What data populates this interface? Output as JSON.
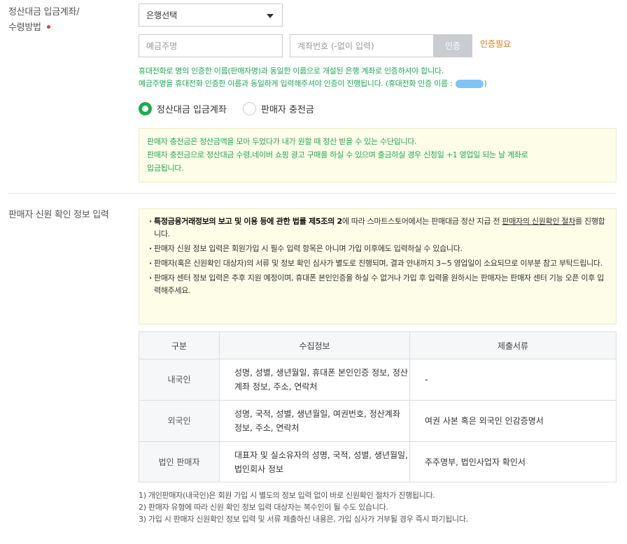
{
  "settlement": {
    "label_line1": "정산대금 입금계좌/",
    "label_line2": "수령방법",
    "bank_select": "은행선택",
    "depositor_placeholder": "예금주명",
    "account_placeholder": "계좌번호 (-없이 입력)",
    "auth_button": "인증",
    "auth_status": "인증필요",
    "note_line1": "휴대전화로 명의 인증한 이름(판매자명)과 동일한 이름으로 개설된 은행 계좌로 인증하셔야 합니다.",
    "note_line2_prefix": "예금주명을 휴대전화 인증한 이름과 동일하게 입력해주셔야 인증이 진행됩니다. (휴대전화 인증 이름 :",
    "note_line2_suffix": ")",
    "radio_account": "정산대금 입금계좌",
    "radio_charge": "판매자 충전금",
    "charge_info_line1": "판매자 충전금은 정산금액을 모아 두었다가 내가 원할 때 정산 받을 수 있는 수단입니다.",
    "charge_info_line2": "판매자 충전금으로 정산대금 수령,네이버 쇼핑 광고 구매를 하실 수 있으며 출금하실 경우 신청일 +1 영업일 되는 날 계좌로",
    "charge_info_line3": "입금됩니다."
  },
  "credit": {
    "label": "판매자 신원 확인 정보 입력",
    "notice1_bold": "특정금융거래정보의 보고 및 이용 등에 관한 법률 제5조의 2",
    "notice1_mid": "에 따라 스마트스토어에서는 판매대금 정산 지급 전 ",
    "notice1_link": "판매자의 신원확인 절차",
    "notice1_end": "를 진행합니다.",
    "notice2": "판매자 신원 정보 입력은 회원가입 시 필수 입력 항목은 아니며 가입 이후에도 입력하실 수 있습니다.",
    "notice3": "판매자(혹은 신원확인 대상자)의 서류 및 정보 확인 심사가 별도로 진행되며, 결과 안내까지 3~5 영업일이 소요되므로 이부분 참고 부탁드립니다.",
    "notice4": "판매자 센터 정보 입력은 추후 지원 예정이며, 휴대폰 본인인증을 하실 수 없거나 가입 후 입력을 원하시는 판매자는 판매자 센터 기능 오픈 이후 입력해주세요.",
    "table": {
      "headers": [
        "구분",
        "수집정보",
        "제출서류"
      ],
      "rows": [
        {
          "type": "내국인",
          "info": "성명, 성별, 생년월일, 휴대폰 본인인증 정보, 정산계좌 정보, 주소, 연락처",
          "docs": "-"
        },
        {
          "type": "외국인",
          "info": "성명, 국적, 성별, 생년월일, 여권번호, 정산계좌 정보, 주소, 연락처",
          "docs": "여권 사본 혹은 외국인 인감증명서"
        },
        {
          "type": "법인 판매자",
          "info": "대표자 및 실소유자의 성명, 국적, 성별, 생년월일, 법인회사 정보",
          "docs": "주주명부, 법인사업자 확인서"
        }
      ]
    },
    "footnotes": [
      "1) 개인판매자(내국인)은 회원 가입 시 별도의 정보 입력 없이 바로 신원확인 절차가 진행됩니다.",
      "2) 판매자 유형에 따라 신원 확인 정보 입력 대상자는 복수인이 될 수도 있습니다.",
      "3) 가입 시 판매자 신원확인 정보 입력 및 서류 제출하신 내용은, 가입 심사가 거부될 경우 즉시 파기됩니다."
    ]
  },
  "colors": {
    "green": "#1faa52",
    "orange": "#e07b18",
    "required_dot": "#e04040",
    "auth_button_bg": "#c9ccd1",
    "notice_bg": "#fdfde8"
  }
}
